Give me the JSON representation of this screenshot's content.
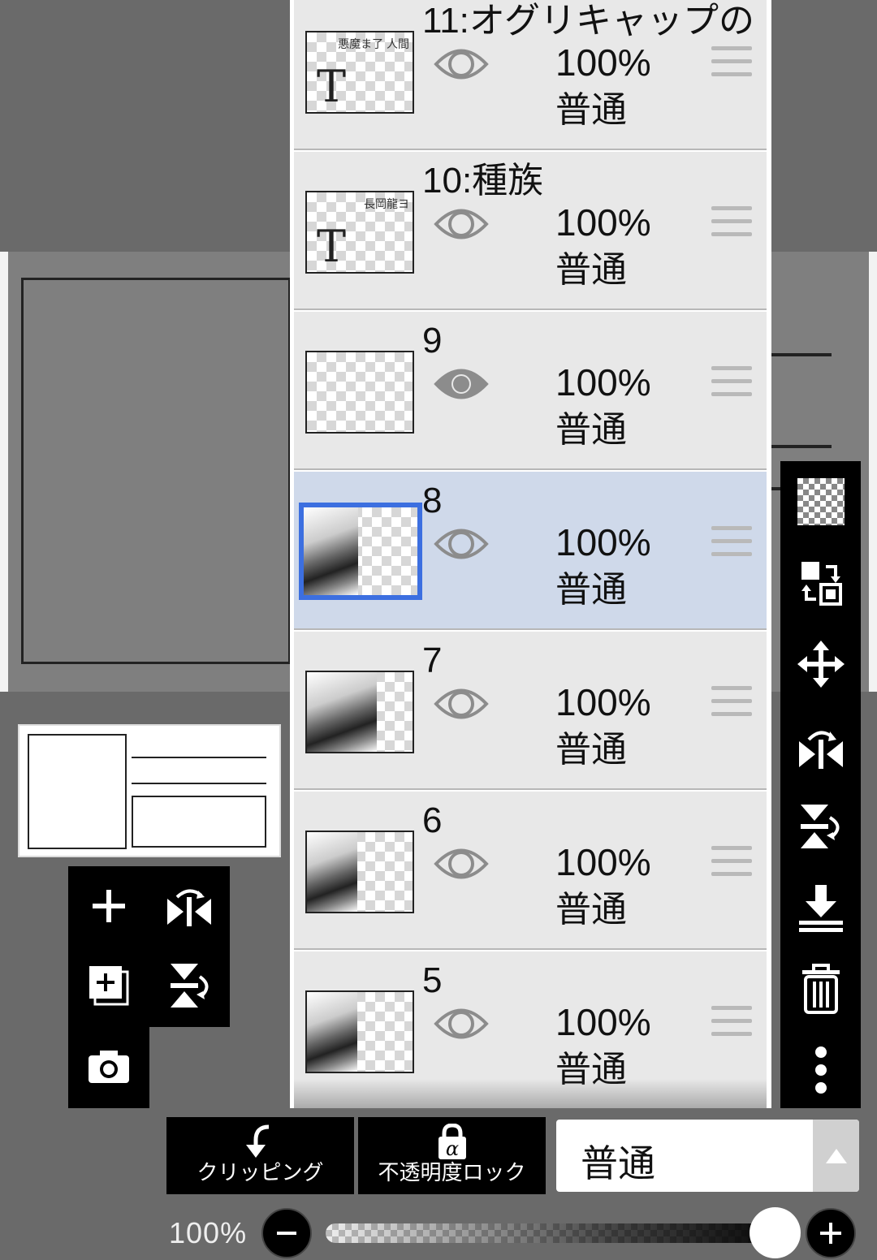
{
  "layers": [
    {
      "name": "11:オグリキャップの",
      "opacity": "100%",
      "blend": "普通",
      "type": "text",
      "thumb_text": "悪魔ま了 人間",
      "visible": true,
      "selected": false
    },
    {
      "name": "10:種族",
      "opacity": "100%",
      "blend": "普通",
      "type": "text",
      "thumb_text": "長岡龍ヨ",
      "visible": true,
      "selected": false
    },
    {
      "name": "9",
      "opacity": "100%",
      "blend": "普通",
      "type": "empty",
      "visible": true,
      "selected": false
    },
    {
      "name": "8",
      "opacity": "100%",
      "blend": "普通",
      "type": "image",
      "visible": true,
      "selected": true
    },
    {
      "name": "7",
      "opacity": "100%",
      "blend": "普通",
      "type": "image",
      "visible": true,
      "selected": false
    },
    {
      "name": "6",
      "opacity": "100%",
      "blend": "普通",
      "type": "image",
      "visible": true,
      "selected": false
    },
    {
      "name": "5",
      "opacity": "100%",
      "blend": "普通",
      "type": "image",
      "visible": true,
      "selected": false
    }
  ],
  "controls": {
    "clipping_label": "クリッピング",
    "opacity_lock_label": "不透明度ロック",
    "blend_mode_value": "普通",
    "opacity_label": "100%",
    "opacity_value": 1.0
  },
  "icons": {
    "right_toolbar": [
      "transparency-icon",
      "swap-layer-icon",
      "move-icon",
      "flip-horizontal-icon",
      "flip-vertical-icon",
      "merge-down-icon",
      "trash-icon",
      "more-icon"
    ],
    "left_pad": [
      "add-layer-icon",
      "flip-horizontal-icon",
      "add-copy-layer-icon",
      "flip-vertical-icon",
      "camera-icon"
    ]
  },
  "colors": {
    "selected_row": "#cfd9ea",
    "selected_thumb_border": "#3c6fe0"
  }
}
